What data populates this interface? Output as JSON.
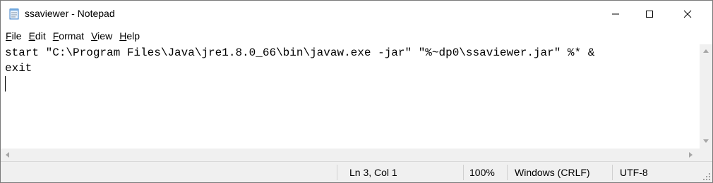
{
  "window": {
    "title": "ssaviewer - Notepad",
    "app_icon": "notepad-icon"
  },
  "caption_buttons": {
    "minimize_icon": "minimize-icon",
    "maximize_icon": "maximize-icon",
    "close_icon": "close-icon"
  },
  "menu": [
    {
      "mnemonic": "F",
      "rest": "ile"
    },
    {
      "mnemonic": "E",
      "rest": "dit"
    },
    {
      "mnemonic": "F",
      "rest": "ormat"
    },
    {
      "mnemonic": "V",
      "rest": "iew"
    },
    {
      "mnemonic": "H",
      "rest": "elp"
    }
  ],
  "editor": {
    "lines": [
      "start \"C:\\Program Files\\Java\\jre1.8.0_66\\bin\\javaw.exe -jar\" \"%~dp0\\ssaviewer.jar\" %* &",
      "exit",
      ""
    ]
  },
  "statusbar": {
    "position": "Ln 3, Col 1",
    "zoom": "100%",
    "line_ending": "Windows (CRLF)",
    "encoding": "UTF-8"
  },
  "colors": {
    "chrome": "#f0f0f0",
    "text": "#000000",
    "scroll_arrow": "#a6a6a6"
  }
}
